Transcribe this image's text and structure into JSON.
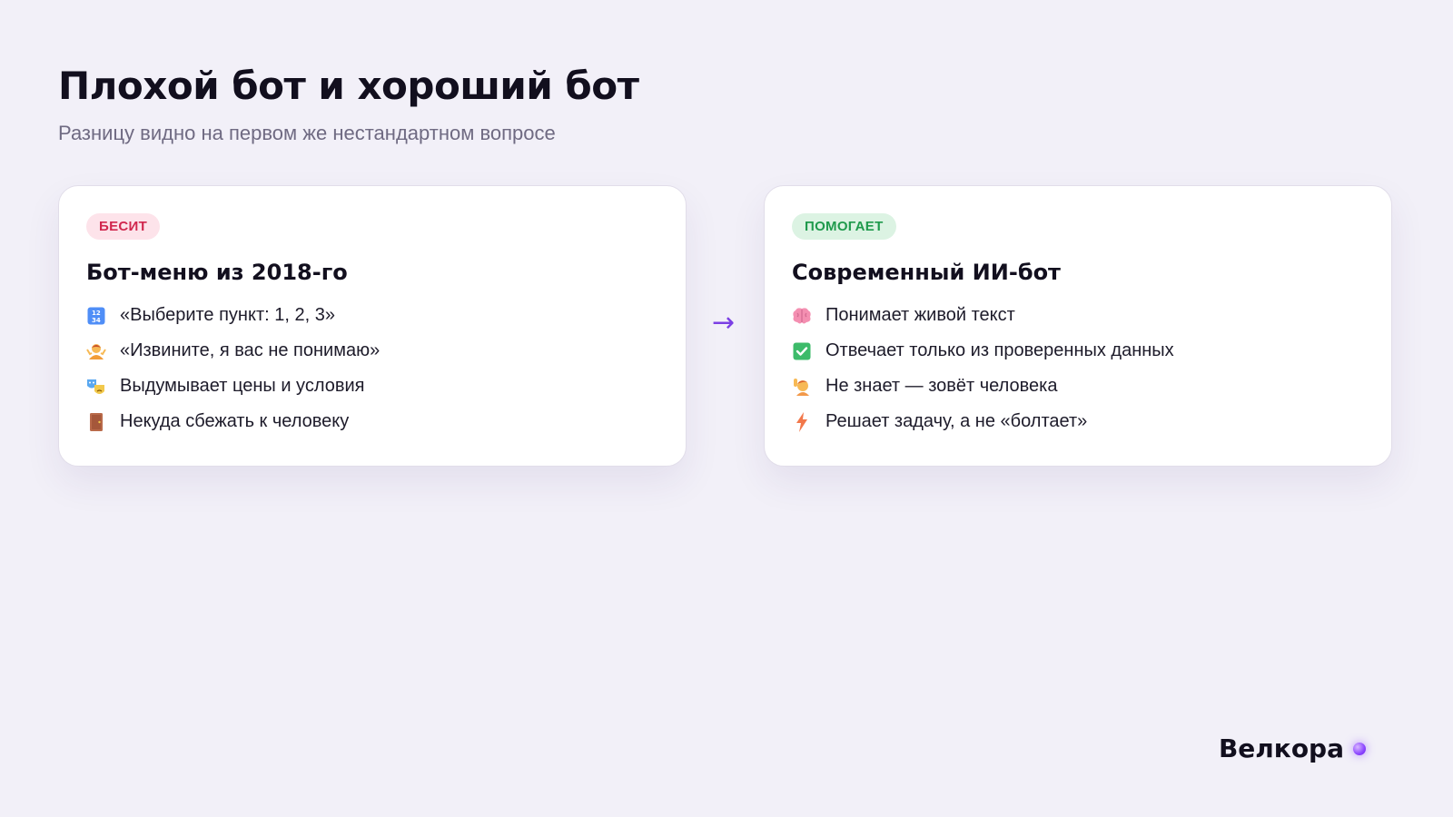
{
  "page": {
    "title": "Плохой бот и хороший бот",
    "subtitle": "Разницу видно на первом же нестандартном вопросе"
  },
  "left_card": {
    "badge": "БЕСИТ",
    "title": "Бот-меню из 2018-го",
    "items": [
      {
        "icon": "numbers-icon",
        "text": "«Выберите пункт: 1, 2, 3»"
      },
      {
        "icon": "shrug-icon",
        "text": "«Извините, я вас не понимаю»"
      },
      {
        "icon": "theater-masks-icon",
        "text": "Выдумывает цены и условия"
      },
      {
        "icon": "door-icon",
        "text": "Некуда сбежать к человеку"
      }
    ]
  },
  "arrow": "→",
  "right_card": {
    "badge": "ПОМОГАЕТ",
    "title": "Современный ИИ-бот",
    "items": [
      {
        "icon": "brain-icon",
        "text": "Понимает живой текст"
      },
      {
        "icon": "check-icon",
        "text": "Отвечает только из проверенных данных"
      },
      {
        "icon": "raised-hand-icon",
        "text": "Не знает — зовёт человека"
      },
      {
        "icon": "lightning-icon",
        "text": "Решает задачу, а не «болтает»"
      }
    ]
  },
  "brand": {
    "name": "Велкора"
  },
  "colors": {
    "background": "#f2f0f8",
    "accent": "#7b3fe4",
    "bad_badge_bg": "#fde3ea",
    "bad_badge_text": "#d1274e",
    "good_badge_bg": "#dcf3e3",
    "good_badge_text": "#1f9a4c"
  }
}
